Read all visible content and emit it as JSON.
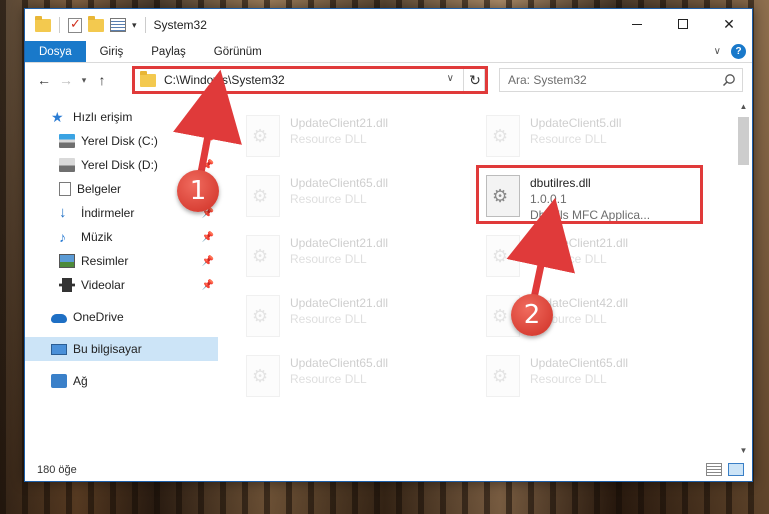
{
  "titlebar": {
    "title": "System32",
    "quick_access_dropdown": "▾"
  },
  "ribbon": {
    "tabs": [
      {
        "label": "Dosya",
        "active": true
      },
      {
        "label": "Giriş",
        "active": false
      },
      {
        "label": "Paylaş",
        "active": false
      },
      {
        "label": "Görünüm",
        "active": false
      }
    ],
    "help": "?"
  },
  "nav": {
    "address": "C:\\Windows\\System32",
    "search_placeholder": "Ara: System32"
  },
  "sidebar": {
    "items": [
      {
        "label": "Hızlı erişim",
        "icon": "star-icon",
        "pinned": false
      },
      {
        "label": "Yerel Disk (C:)",
        "icon": "drive-icon",
        "pinned": true
      },
      {
        "label": "Yerel Disk (D:)",
        "icon": "drive-icon",
        "pinned": true
      },
      {
        "label": "Belgeler",
        "icon": "documents-icon",
        "pinned": true
      },
      {
        "label": "İndirmeler",
        "icon": "download-icon",
        "pinned": true
      },
      {
        "label": "Müzik",
        "icon": "music-icon",
        "pinned": true
      },
      {
        "label": "Resimler",
        "icon": "pictures-icon",
        "pinned": true
      },
      {
        "label": "Videolar",
        "icon": "videos-icon",
        "pinned": true
      },
      {
        "label": "OneDrive",
        "icon": "cloud-icon",
        "pinned": false
      },
      {
        "label": "Bu bilgisayar",
        "icon": "computer-icon",
        "pinned": false,
        "selected": true
      },
      {
        "label": "Ağ",
        "icon": "network-icon",
        "pinned": false
      }
    ]
  },
  "files": {
    "ghost": [
      {
        "name": "UpdateClient21.dll",
        "sub": "Resource DLL"
      },
      {
        "name": "UpdateClient5.dll",
        "sub": "Resource DLL"
      },
      {
        "name": "UpdateClient65.dll",
        "sub": "Resource DLL"
      },
      {
        "name": "UpdateClient21.dll",
        "sub": "Resource DLL"
      },
      {
        "name": "UpdateClient21.dll",
        "sub": "Resource DLL"
      },
      {
        "name": "UpdateClient21.dll",
        "sub": "Resource DLL"
      },
      {
        "name": "UpdateClient42.dll",
        "sub": "Resource DLL"
      },
      {
        "name": "UpdateClient65.dll",
        "sub": "Resource DLL"
      },
      {
        "name": "UpdateClient65.dll",
        "sub": "Resource DLL"
      }
    ],
    "highlight": {
      "name": "dbutilres.dll",
      "version": "1.0.0.1",
      "description": "DbUtils MFC Applica..."
    }
  },
  "status": {
    "item_count": "180 öğe"
  },
  "annotations": {
    "badge1": "1",
    "badge2": "2",
    "color": "#e03a3a"
  }
}
